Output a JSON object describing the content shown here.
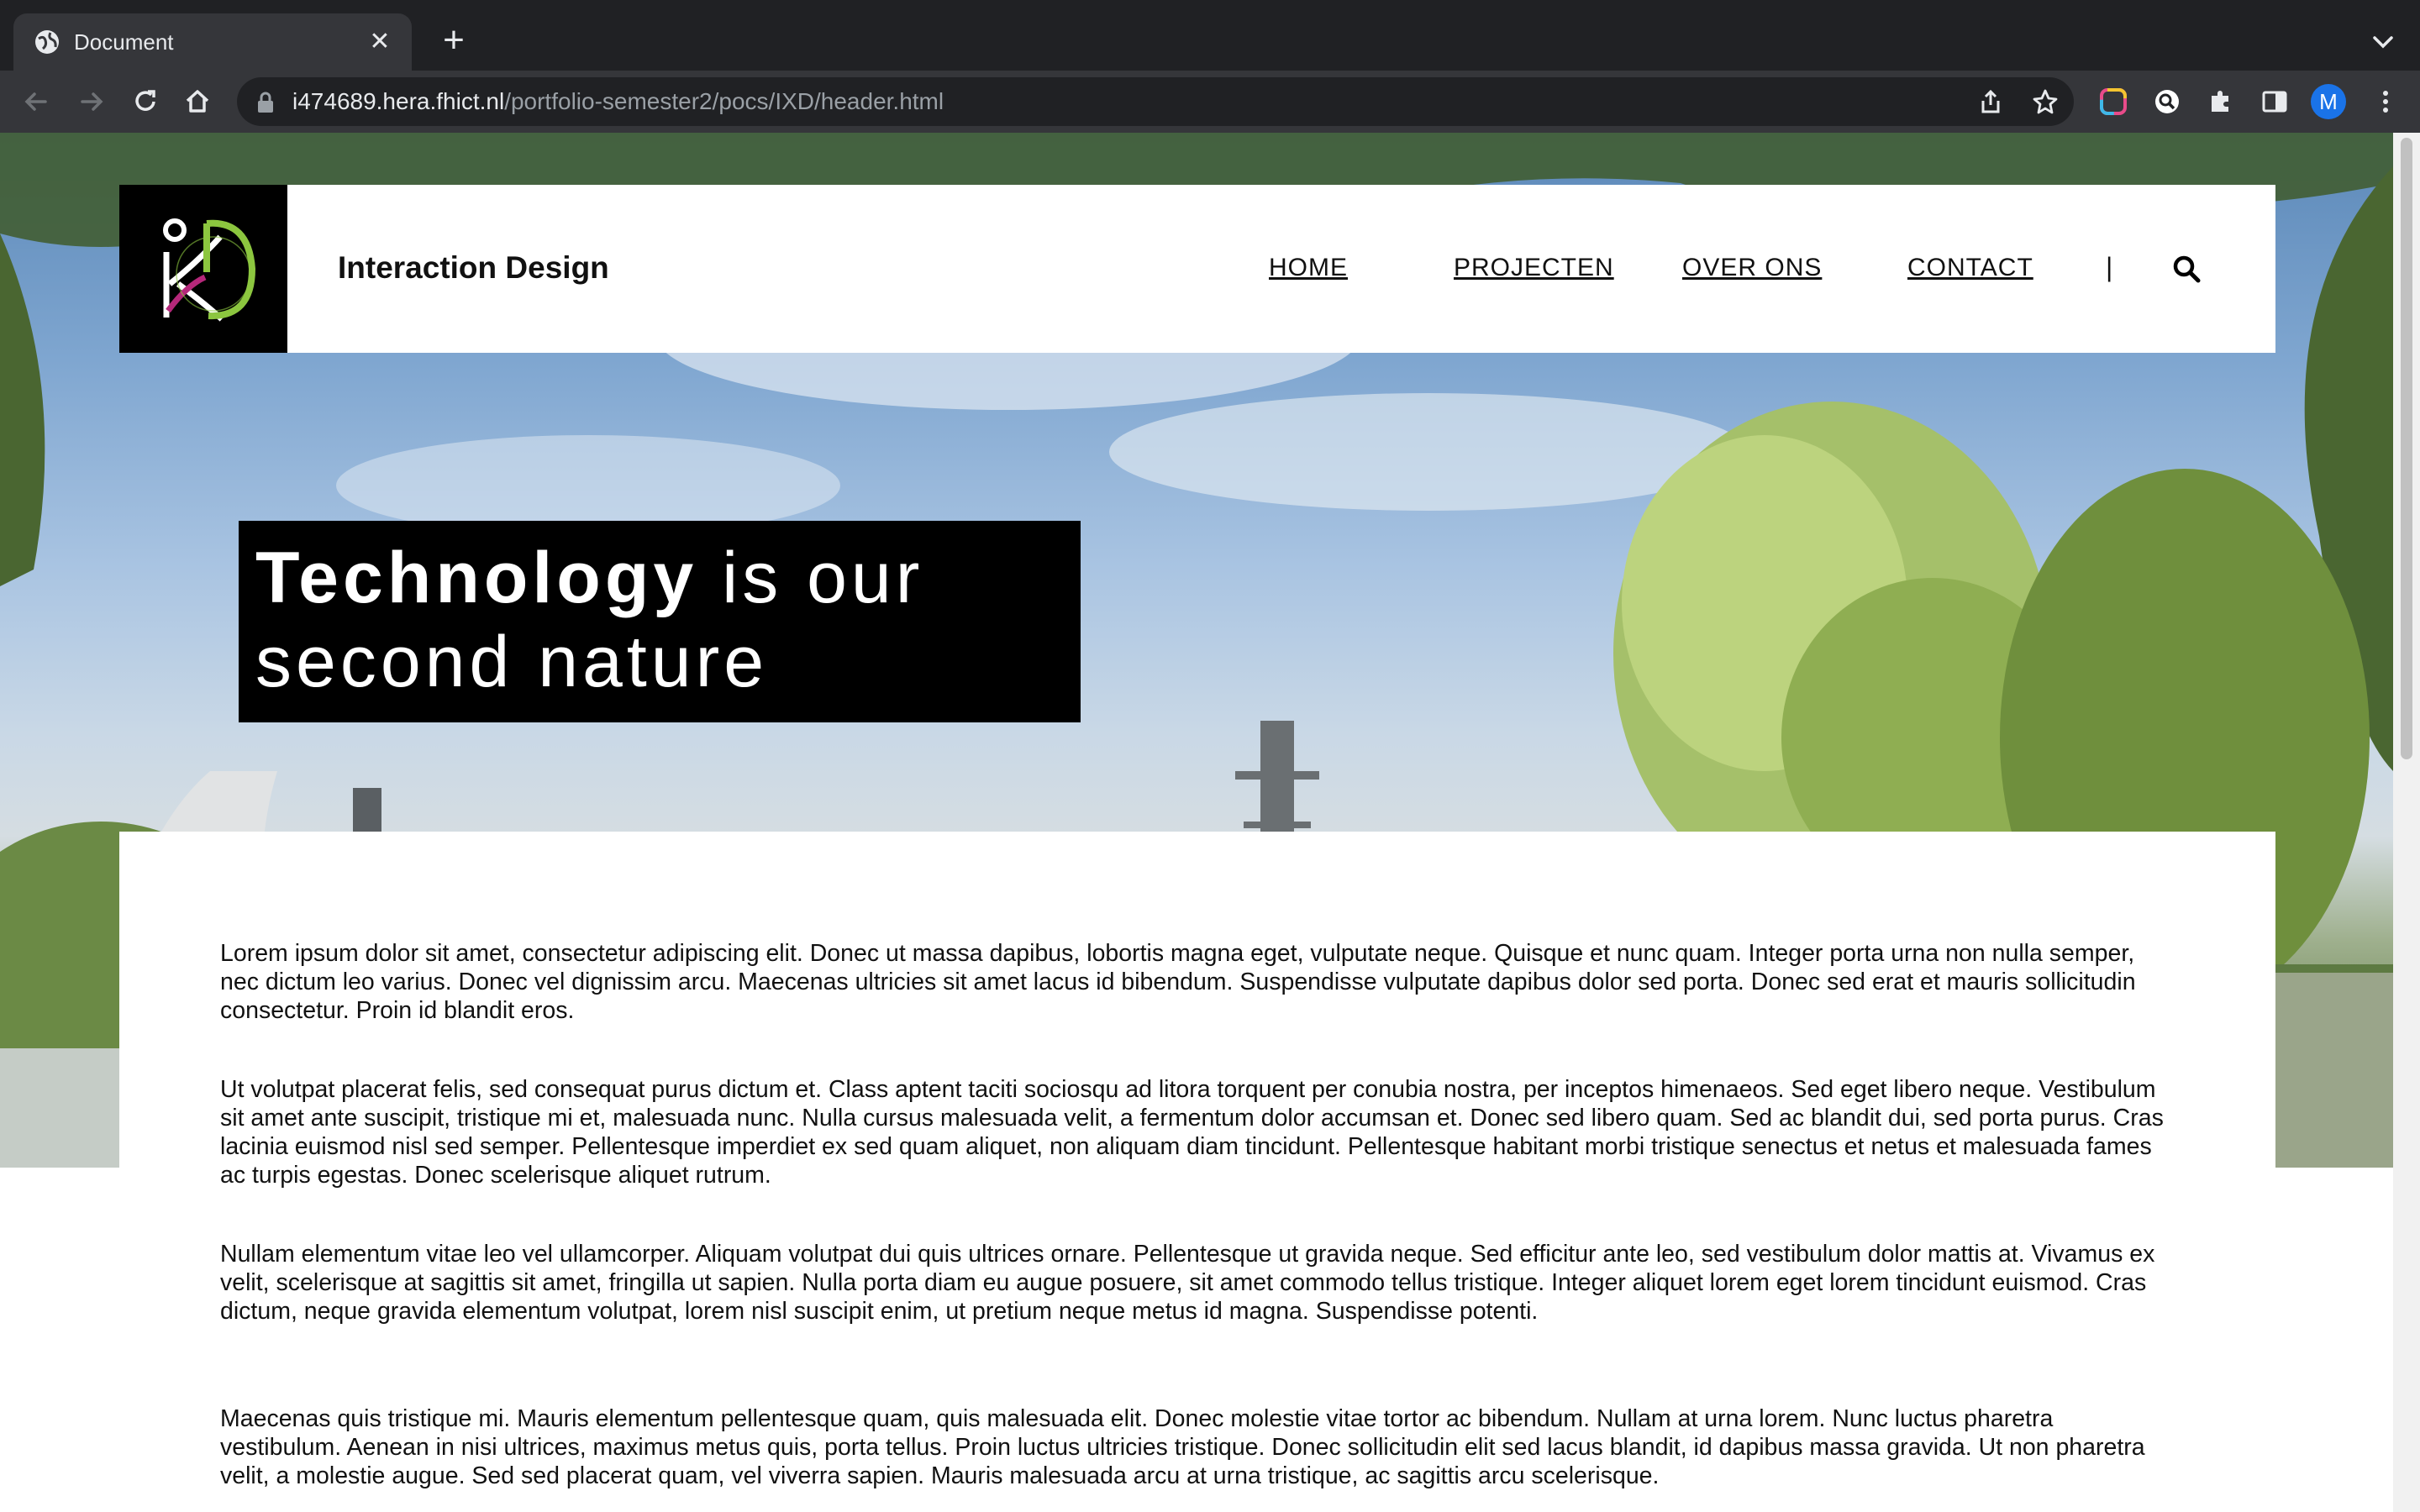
{
  "browser": {
    "tab": {
      "title": "Document",
      "close": "✕"
    },
    "new_tab": "+",
    "url": {
      "host": "i474689.hera.fhict.nl",
      "path": "/portfolio-semester2/pocs/IXD/header.html"
    },
    "profile_initial": "M"
  },
  "site": {
    "name": "Interaction Design",
    "nav": [
      {
        "label": "HOME"
      },
      {
        "label": "PROJECTEN"
      },
      {
        "label": "OVER ONS"
      },
      {
        "label": "CONTACT"
      }
    ],
    "separator": "|"
  },
  "hero": {
    "headline_bold": "Technology",
    "headline_rest_1": " is our",
    "headline_rest_2": "second nature"
  },
  "content": {
    "paragraphs": [
      "Lorem ipsum dolor sit amet, consectetur adipiscing elit. Donec ut massa dapibus, lobortis magna eget, vulputate neque. Quisque et nunc quam. Integer porta urna non nulla semper, nec dictum leo varius. Donec vel dignissim arcu. Maecenas ultricies sit amet lacus id bibendum. Suspendisse vulputate dapibus dolor sed porta. Donec sed erat et mauris sollicitudin consectetur. Proin id blandit eros.",
      "Ut volutpat placerat felis, sed consequat purus dictum et. Class aptent taciti sociosqu ad litora torquent per conubia nostra, per inceptos himenaeos. Sed eget libero neque. Vestibulum sit amet ante suscipit, tristique mi et, malesuada nunc. Nulla cursus malesuada velit, a fermentum dolor accumsan et. Donec sed libero quam. Sed ac blandit dui, sed porta purus. Cras lacinia euismod nisl sed semper. Pellentesque imperdiet ex sed quam aliquet, non aliquam diam tincidunt. Pellentesque habitant morbi tristique senectus et netus et malesuada fames ac turpis egestas. Donec scelerisque aliquet rutrum.",
      "Nullam elementum vitae leo vel ullamcorper. Aliquam volutpat dui quis ultrices ornare. Pellentesque ut gravida neque. Sed efficitur ante leo, sed vestibulum dolor mattis at. Vivamus ex velit, scelerisque at sagittis sit amet, fringilla ut sapien. Nulla porta diam eu augue posuere, sit amet commodo tellus tristique. Integer aliquet lorem eget lorem tincidunt euismod. Cras dictum, neque gravida elementum volutpat, lorem nisl suscipit enim, ut pretium neque metus id magna. Suspendisse potenti.",
      "Maecenas quis tristique mi. Mauris elementum pellentesque quam, quis malesuada elit. Donec molestie vitae tortor ac bibendum. Nullam at urna lorem. Nunc luctus pharetra vestibulum. Aenean in nisi ultrices, maximus metus quis, porta tellus. Proin luctus ultricies tristique. Donec sollicitudin elit sed lacus blandit, id dapibus massa gravida. Ut non pharetra velit, a molestie augue. Sed sed placerat quam, vel viverra sapien. Mauris malesuada arcu at urna tristique, ac sagittis arcu scelerisque."
    ]
  },
  "colors": {
    "chrome_dark": "#202124",
    "chrome_toolbar": "#35363a",
    "profile_blue": "#1a73e8",
    "logo_green": "#8cc63f",
    "logo_magenta": "#b5287a"
  }
}
